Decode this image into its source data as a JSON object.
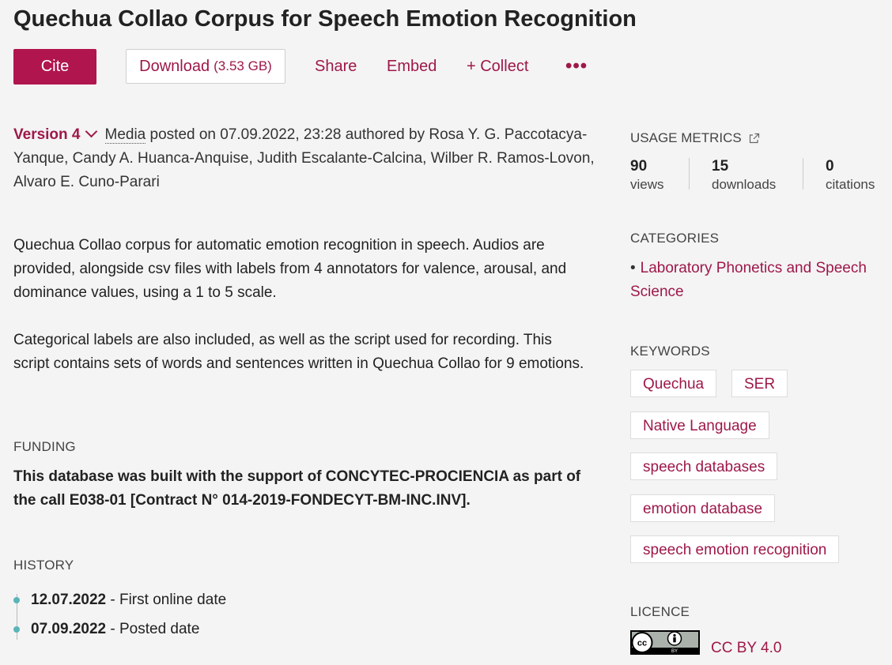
{
  "title": "Quechua Collao Corpus for Speech Emotion Recognition",
  "actions": {
    "cite": "Cite",
    "download_label": "Download",
    "download_size": "(3.53 GB)",
    "share": "Share",
    "embed": "Embed",
    "collect": "+ Collect",
    "more": "•••"
  },
  "meta": {
    "version": "Version 4",
    "media": "Media",
    "posted_text": " posted on 07.09.2022, 23:28 authored by Rosa Y. G. Paccotacya-Yanque, Candy A. Huanca-Anquise, Judith Escalante-Calcina, Wilber R. Ramos-Lovon, Alvaro E. Cuno-Parari"
  },
  "description": [
    "Quechua Collao corpus for automatic emotion recognition in speech. Audios are provided, alongside csv files with labels from 4 annotators for valence, arousal, and dominance values, using a 1 to 5 scale.",
    "Categorical labels are also included, as well as the script used for recording. This script contains sets of words and sentences written in Quechua Collao for 9 emotions."
  ],
  "funding": {
    "label": "FUNDING",
    "text": "This database was built with the support of CONCYTEC-PROCIENCIA as part of the call E038-01 [Contract N° 014-2019-FONDECYT-BM-INC.INV]."
  },
  "history": {
    "label": "HISTORY",
    "items": [
      {
        "date": "12.07.2022",
        "text": " - First online date"
      },
      {
        "date": "07.09.2022",
        "text": " - Posted date"
      }
    ]
  },
  "usage": {
    "label": "USAGE METRICS",
    "metrics": [
      {
        "value": "90",
        "label": "views"
      },
      {
        "value": "15",
        "label": "downloads"
      },
      {
        "value": "0",
        "label": "citations"
      }
    ]
  },
  "categories": {
    "label": "CATEGORIES",
    "items": [
      "Laboratory Phonetics and Speech Science"
    ]
  },
  "keywords": {
    "label": "KEYWORDS",
    "items": [
      "Quechua",
      "SER",
      "Native Language",
      "speech databases",
      "emotion database",
      "speech emotion recognition"
    ]
  },
  "licence": {
    "label": "LICENCE",
    "name": "CC BY 4.0",
    "badge_text": "BY"
  },
  "colors": {
    "accent": "#b0154d",
    "link": "#9e1848",
    "timeline_dot": "#5ab4b8",
    "background": "#f4f4f4"
  }
}
